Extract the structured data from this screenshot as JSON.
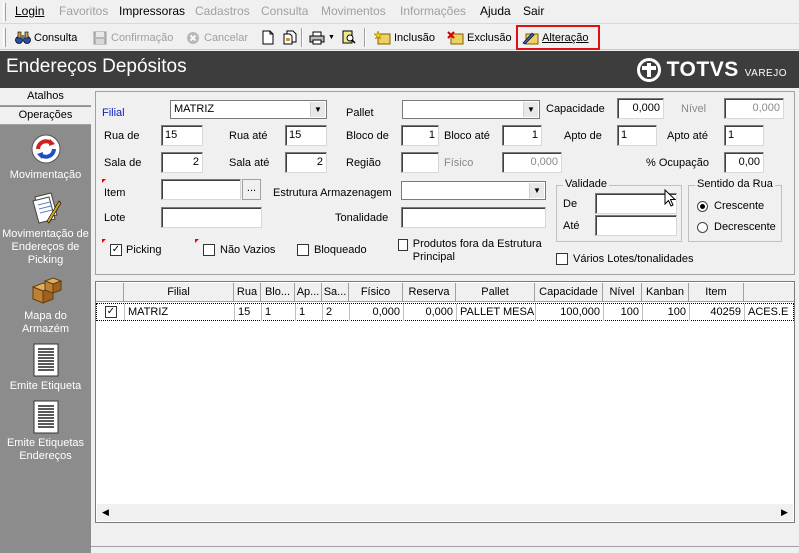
{
  "menu": [
    {
      "label": "Login",
      "enabled": true
    },
    {
      "label": "Favoritos",
      "enabled": false
    },
    {
      "label": "Impressoras",
      "enabled": true
    },
    {
      "label": "Cadastros",
      "enabled": false
    },
    {
      "label": "Consulta",
      "enabled": false
    },
    {
      "label": "Movimentos",
      "enabled": false
    },
    {
      "label": "Informações",
      "enabled": false
    },
    {
      "label": "Ajuda",
      "enabled": true
    },
    {
      "label": "Sair",
      "enabled": true
    }
  ],
  "toolbar": {
    "consulta": "Consulta",
    "confirmacao": "Confirmação",
    "cancelar": "Cancelar",
    "inclusao": "Inclusão",
    "exclusao": "Exclusão",
    "alteracao": "Alteração",
    "highlight_color": "#e01010"
  },
  "header": {
    "title": "Endereços Depósitos",
    "brand": "TOTVS",
    "brand_sub": "VAREJO",
    "bg_color": "#3d3d3d"
  },
  "sidebar": {
    "tabs": [
      "Atalhos",
      "Operações"
    ],
    "items": [
      {
        "label": "Movimentação",
        "icon": "refresh-arrows-icon"
      },
      {
        "label": "Movimentação de Endereços de Picking",
        "icon": "documents-pencil-icon"
      },
      {
        "label": "Mapa do Armazém",
        "icon": "boxes-icon"
      },
      {
        "label": "Emite Etiqueta",
        "icon": "barcode-label-icon"
      },
      {
        "label": "Emite Etiquetas Endereços",
        "icon": "barcode-labels-icon"
      }
    ]
  },
  "form": {
    "filial_label": "Filial",
    "filial_value": "MATRIZ",
    "pallet_label": "Pallet",
    "pallet_value": "",
    "capacidade_label": "Capacidade",
    "capacidade_value": "0,000",
    "nivel_label": "Nível",
    "nivel_value": "0,000",
    "rua_de_label": "Rua de",
    "rua_de_value": "15",
    "rua_ate_label": "Rua até",
    "rua_ate_value": "15",
    "bloco_de_label": "Bloco de",
    "bloco_de_value": "1",
    "bloco_ate_label": "Bloco até",
    "bloco_ate_value": "1",
    "apto_de_label": "Apto de",
    "apto_de_value": "1",
    "apto_ate_label": "Apto até",
    "apto_ate_value": "1",
    "sala_de_label": "Sala de",
    "sala_de_value": "2",
    "sala_ate_label": "Sala até",
    "sala_ate_value": "2",
    "regiao_label": "Região",
    "regiao_value": "",
    "fisico_label": "Físico",
    "fisico_value": "0,000",
    "ocupacao_label": "% Ocupação",
    "ocupacao_value": "0,00",
    "item_label": "Item",
    "item_value": "",
    "item_button": "...",
    "estrutura_label": "Estrutura Armazenagem",
    "estrutura_value": "",
    "lote_label": "Lote",
    "lote_value": "",
    "tonalidade_label": "Tonalidade",
    "tonalidade_value": "",
    "validade_label": "Validade",
    "validade_de_label": "De",
    "validade_ate_label": "Até",
    "sentido_label": "Sentido da Rua",
    "sentido_options": [
      "Crescente",
      "Decrescente"
    ],
    "sentido_selected": "Crescente",
    "picking_label": "Picking",
    "picking_checked": true,
    "nao_vazios_label": "Não Vazios",
    "nao_vazios_checked": false,
    "bloqueado_label": "Bloqueado",
    "bloqueado_checked": false,
    "produtos_fora_label": "Produtos fora da Estrutura Principal",
    "produtos_fora_checked": false,
    "varios_lotes_label": "Vários Lotes/tonalidades",
    "varios_lotes_checked": false
  },
  "grid": {
    "columns": [
      "",
      "Filial",
      "Rua",
      "Blo...",
      "Ap...",
      "Sa...",
      "Físico",
      "Reserva",
      "Pallet",
      "Capacidade",
      "Nível",
      "Kanban",
      "Item",
      ""
    ],
    "rows": [
      {
        "checked": true,
        "filial": "MATRIZ",
        "rua": "15",
        "bloco": "1",
        "apto": "1",
        "sala": "2",
        "fisico": "0,000",
        "reserva": "0,000",
        "pallet": "PALLET MESA",
        "capacidade": "100,000",
        "nivel": "100",
        "kanban": "100",
        "item": "40259",
        "desc": "ACES.E"
      }
    ]
  }
}
